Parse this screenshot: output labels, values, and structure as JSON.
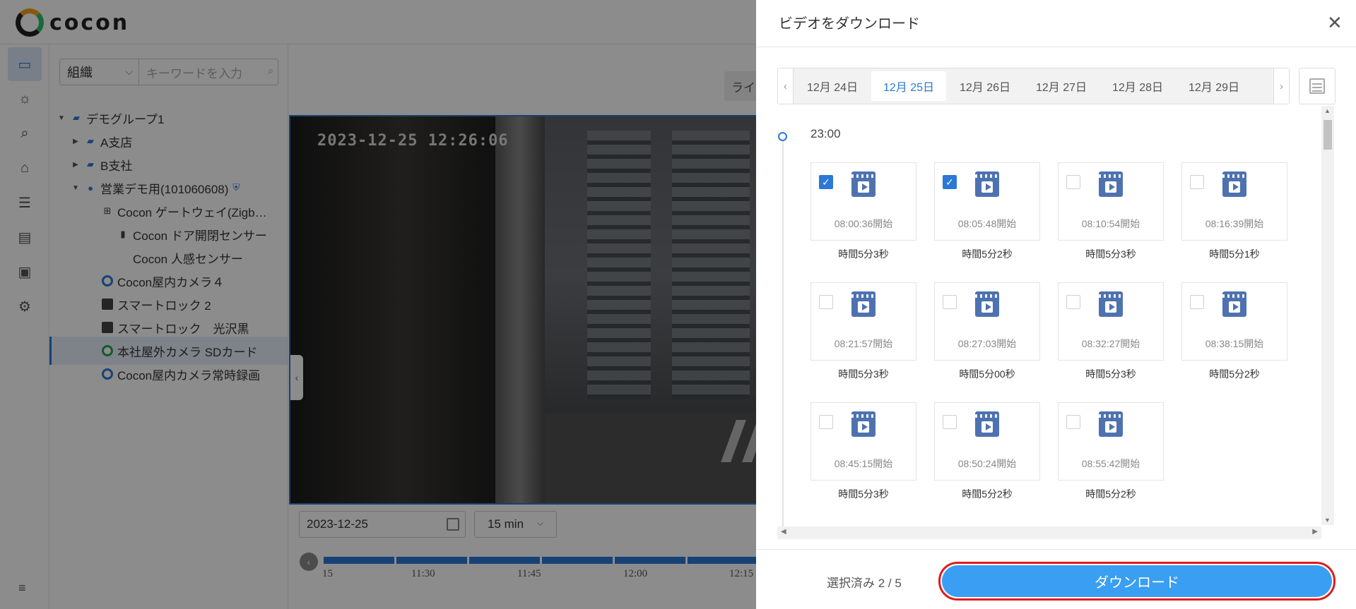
{
  "app": {
    "logo_text": "cocon"
  },
  "tree": {
    "select_value": "組織",
    "search_placeholder": "キーワードを入力",
    "items": [
      {
        "label": "デモグループ1"
      },
      {
        "label": "A支店"
      },
      {
        "label": "B支社"
      },
      {
        "label": "営業デモ用(101060608)"
      },
      {
        "label": "Cocon ゲートウェイ(Zigb…"
      },
      {
        "label": "Cocon ドア開閉センサー"
      },
      {
        "label": "Cocon 人感センサー"
      },
      {
        "label": "Cocon屋内カメラ４"
      },
      {
        "label": "スマートロック 2"
      },
      {
        "label": "スマートロック　光沢黒"
      },
      {
        "label": "本社屋外カメラ SDカード"
      },
      {
        "label": "Cocon屋内カメラ常時録画"
      }
    ]
  },
  "main": {
    "live_tab": "ライ",
    "timestamp": "2023-12-25  12:26:06",
    "date_value": "2023-12-25",
    "interval_value": "15 min",
    "timeline_labels": [
      "15",
      "11:30",
      "11:45",
      "12:00",
      "12:15"
    ]
  },
  "drawer": {
    "title": "ビデオをダウンロード",
    "dates": [
      "12月 24日",
      "12月 25日",
      "12月 26日",
      "12月 27日",
      "12月 28日",
      "12月 29日"
    ],
    "active_date_index": 1,
    "hour": "23:00",
    "clips": [
      {
        "start": "08:00:36開始",
        "duration": "時間5分3秒",
        "checked": true
      },
      {
        "start": "08:05:48開始",
        "duration": "時間5分2秒",
        "checked": true
      },
      {
        "start": "08:10:54開始",
        "duration": "時間5分3秒",
        "checked": false
      },
      {
        "start": "08:16:39開始",
        "duration": "時間5分1秒",
        "checked": false
      },
      {
        "start": "08:21:57開始",
        "duration": "時間5分3秒",
        "checked": false
      },
      {
        "start": "08:27:03開始",
        "duration": "時間5分00秒",
        "checked": false
      },
      {
        "start": "08:32:27開始",
        "duration": "時間5分3秒",
        "checked": false
      },
      {
        "start": "08:38:15開始",
        "duration": "時間5分2秒",
        "checked": false
      },
      {
        "start": "08:45:15開始",
        "duration": "時間5分3秒",
        "checked": false
      },
      {
        "start": "08:50:24開始",
        "duration": "時間5分2秒",
        "checked": false
      },
      {
        "start": "08:55:42開始",
        "duration": "時間5分2秒",
        "checked": false
      }
    ],
    "selected_count": "選択済み 2 / 5",
    "download_label": "ダウンロード"
  },
  "colors": {
    "accent": "#2b78d6",
    "button": "#3a9ef2",
    "highlight_border": "#e01b1b"
  }
}
